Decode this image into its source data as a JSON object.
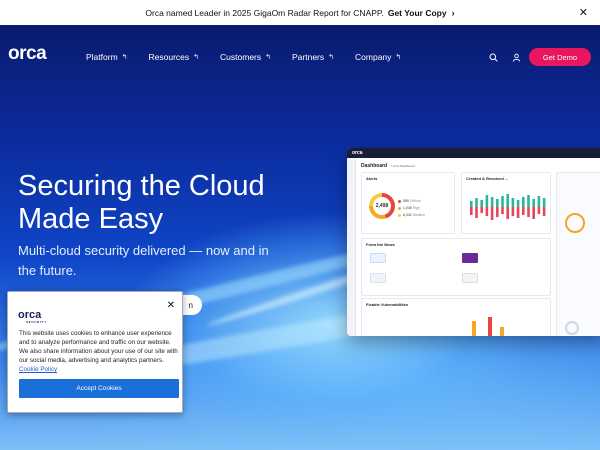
{
  "announcement": {
    "text": "Orca named Leader in 2025 GigaOm Radar Report for CNAPP.",
    "cta": "Get Your Copy",
    "chevron": "›",
    "close": "✕"
  },
  "brand": {
    "logo_text": "orca",
    "logo_sub": "SECURITY"
  },
  "nav": {
    "items": [
      {
        "label": "Platform",
        "caret": "↰"
      },
      {
        "label": "Resources",
        "caret": "↰"
      },
      {
        "label": "Customers",
        "caret": "↰"
      },
      {
        "label": "Partners",
        "caret": "↰"
      },
      {
        "label": "Company",
        "caret": "↰"
      }
    ],
    "search_icon": "search-icon",
    "user_icon": "user-icon",
    "demo_button": "Get Demo"
  },
  "hero": {
    "title": "Securing the Cloud Made Easy",
    "subtitle": "Multi-cloud security delivered — now and in the future.",
    "button_label": "n"
  },
  "dashboard": {
    "logo": "orca",
    "title": "Dashboard",
    "breadcrumb": "/ Orca Dashboard",
    "alerts_title": "Alerts",
    "alerts_total": "2,498",
    "alerts_breakdown": [
      {
        "value": "559",
        "label": "Critical",
        "color": "#e8453c"
      },
      {
        "value": "1,045",
        "label": "High",
        "color": "#f5a623"
      },
      {
        "value": "6,342",
        "label": "Medium",
        "color": "#f7c948"
      }
    ],
    "trend_title": "Created & Resolved ...",
    "news_title": "From the News",
    "vuln_title": "Fixable Vulnerabilities"
  },
  "cookie": {
    "logo_text": "orca",
    "logo_sub": "SECURITY",
    "close": "✕",
    "body": "This website uses cookies to enhance user experience and to analyze performance and traffic on our website. We also share information about your use of our site with our social media, advertising and analytics partners.",
    "policy_link": "Cookie Policy",
    "accept": "Accept Cookies"
  },
  "colors": {
    "accent": "#e8155f",
    "accept_button": "#1a6fd8",
    "announce_bg": "#ffffff",
    "hero_top": "#0a1b6e",
    "hero_bottom": "#7ec0f7"
  }
}
